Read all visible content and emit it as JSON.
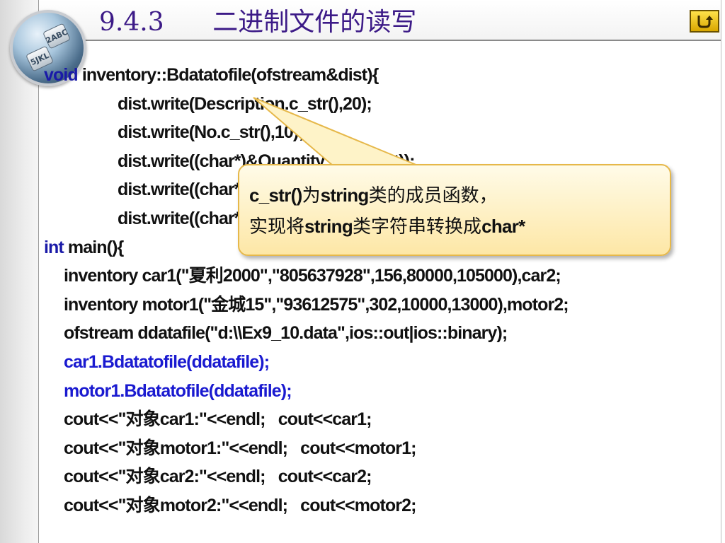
{
  "slide": {
    "title": "9.4.3      二进制文件的读写",
    "back_button_label": "back-arrow",
    "logo_keys": [
      "2ABC",
      "5JKL"
    ]
  },
  "code": {
    "lines": [
      {
        "segments": [
          {
            "text": "void",
            "style": "kw"
          },
          {
            "text": " inventory::Bdatatofile(ofstream&dist){",
            "style": ""
          }
        ],
        "indent": 0
      },
      {
        "segments": [
          {
            "text": "dist.write(Description.c_str(),20);",
            "style": ""
          }
        ],
        "indent": 1
      },
      {
        "segments": [
          {
            "text": "dist.write(No.c_str(),10);",
            "style": ""
          }
        ],
        "indent": 1
      },
      {
        "segments": [
          {
            "text": "dist.write((char*)&Quantity,sizeof(int));",
            "style": ""
          }
        ],
        "indent": 1
      },
      {
        "segments": [
          {
            "text": "dist.write((char*)&Cost,sizeof(double));",
            "style": ""
          }
        ],
        "indent": 1
      },
      {
        "segments": [
          {
            "text": "dist.write((char*)&Retail,sizeof(double));}",
            "style": ""
          }
        ],
        "indent": 1
      },
      {
        "segments": [
          {
            "text": "int",
            "style": "kw"
          },
          {
            "text": " main(){",
            "style": ""
          }
        ],
        "indent": 0
      },
      {
        "segments": [
          {
            "text": "inventory car1(\"夏利2000\",\"805637928\",156,80000,105000),car2;",
            "style": ""
          }
        ],
        "indent": 2
      },
      {
        "segments": [
          {
            "text": "inventory motor1(\"金城15\",\"93612575\",302,10000,13000),motor2;",
            "style": ""
          }
        ],
        "indent": 2
      },
      {
        "segments": [
          {
            "text": "ofstream ddatafile(\"d:\\\\Ex9_10.data\",ios::out|ios::binary);",
            "style": ""
          }
        ],
        "indent": 2
      },
      {
        "segments": [
          {
            "text": "car1.Bdatatofile(ddatafile);",
            "style": "blue"
          }
        ],
        "indent": 2
      },
      {
        "segments": [
          {
            "text": "motor1.Bdatatofile(ddatafile);",
            "style": "blue"
          }
        ],
        "indent": 2
      },
      {
        "segments": [
          {
            "text": "cout<<\"对象car1:\"<<endl;   cout<<car1;",
            "style": ""
          }
        ],
        "indent": 2
      },
      {
        "segments": [
          {
            "text": "cout<<\"对象motor1:\"<<endl;   cout<<motor1;",
            "style": ""
          }
        ],
        "indent": 2
      },
      {
        "segments": [
          {
            "text": "cout<<\"对象car2:\"<<endl;   cout<<car2;",
            "style": ""
          }
        ],
        "indent": 2
      },
      {
        "segments": [
          {
            "text": "cout<<\"对象motor2:\"<<endl;   cout<<motor2;",
            "style": ""
          }
        ],
        "indent": 2
      }
    ]
  },
  "callout": {
    "line1_a": "c_str()",
    "line1_b": "为",
    "line1_c": "string",
    "line1_d": "类的成员函数，",
    "line2_a": "实现将",
    "line2_b": "string",
    "line2_c": "类字符串转换成",
    "line2_d": "char*"
  },
  "colors": {
    "title": "#3c1a87",
    "keyword": "#1a1aa8",
    "highlight_call": "#1a1ad0",
    "callout_fill": "#fde7a6",
    "callout_border": "#e6b84a",
    "back_button": "#f3c400"
  }
}
